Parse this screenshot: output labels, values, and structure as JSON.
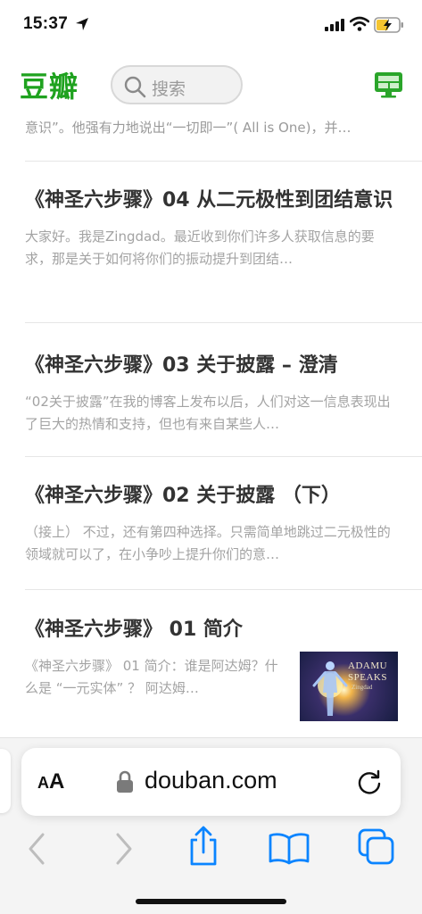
{
  "status_bar": {
    "time": "15:37"
  },
  "header": {
    "logo": "豆瓣",
    "search_placeholder": "搜索"
  },
  "feed": {
    "partial_summary": "意识”。他强有力地说出“一切即一”( All is One)，并…",
    "articles": [
      {
        "title": "《神圣六步骤》04 从二元极性到团结意识",
        "summary": "大家好。我是Zingdad。最近收到你们许多人获取信息的要求，那是关于如何将你们的振动提升到团结…"
      },
      {
        "title": "《神圣六步骤》03 关于披露 – 澄清",
        "summary": "“02关于披露”在我的博客上发布以后，人们对这一信息表现出了巨大的热情和支持，但也有来自某些人…"
      },
      {
        "title": "《神圣六步骤》02 关于披露 （下）",
        "summary": "（接上） 不过，还有第四种选择。只需简单地跳过二元极性的领域就可以了，在小争吵上提升你们的意…"
      },
      {
        "title": "《神圣六步骤》 01 简介",
        "summary": "《神圣六步骤》 01 简介：谁是阿达姆？什么是 “一元实体” ？ 阿达姆…",
        "thumbnail": {
          "title_line1": "ADAMU",
          "title_line2": "SPEAKS",
          "subtitle": "Zingdad"
        }
      }
    ]
  },
  "browser": {
    "aa_small": "A",
    "aa_big": "A",
    "url": "douban.com"
  },
  "colors": {
    "brand_green": "#1fa21f",
    "ios_blue": "#0a84ff"
  }
}
